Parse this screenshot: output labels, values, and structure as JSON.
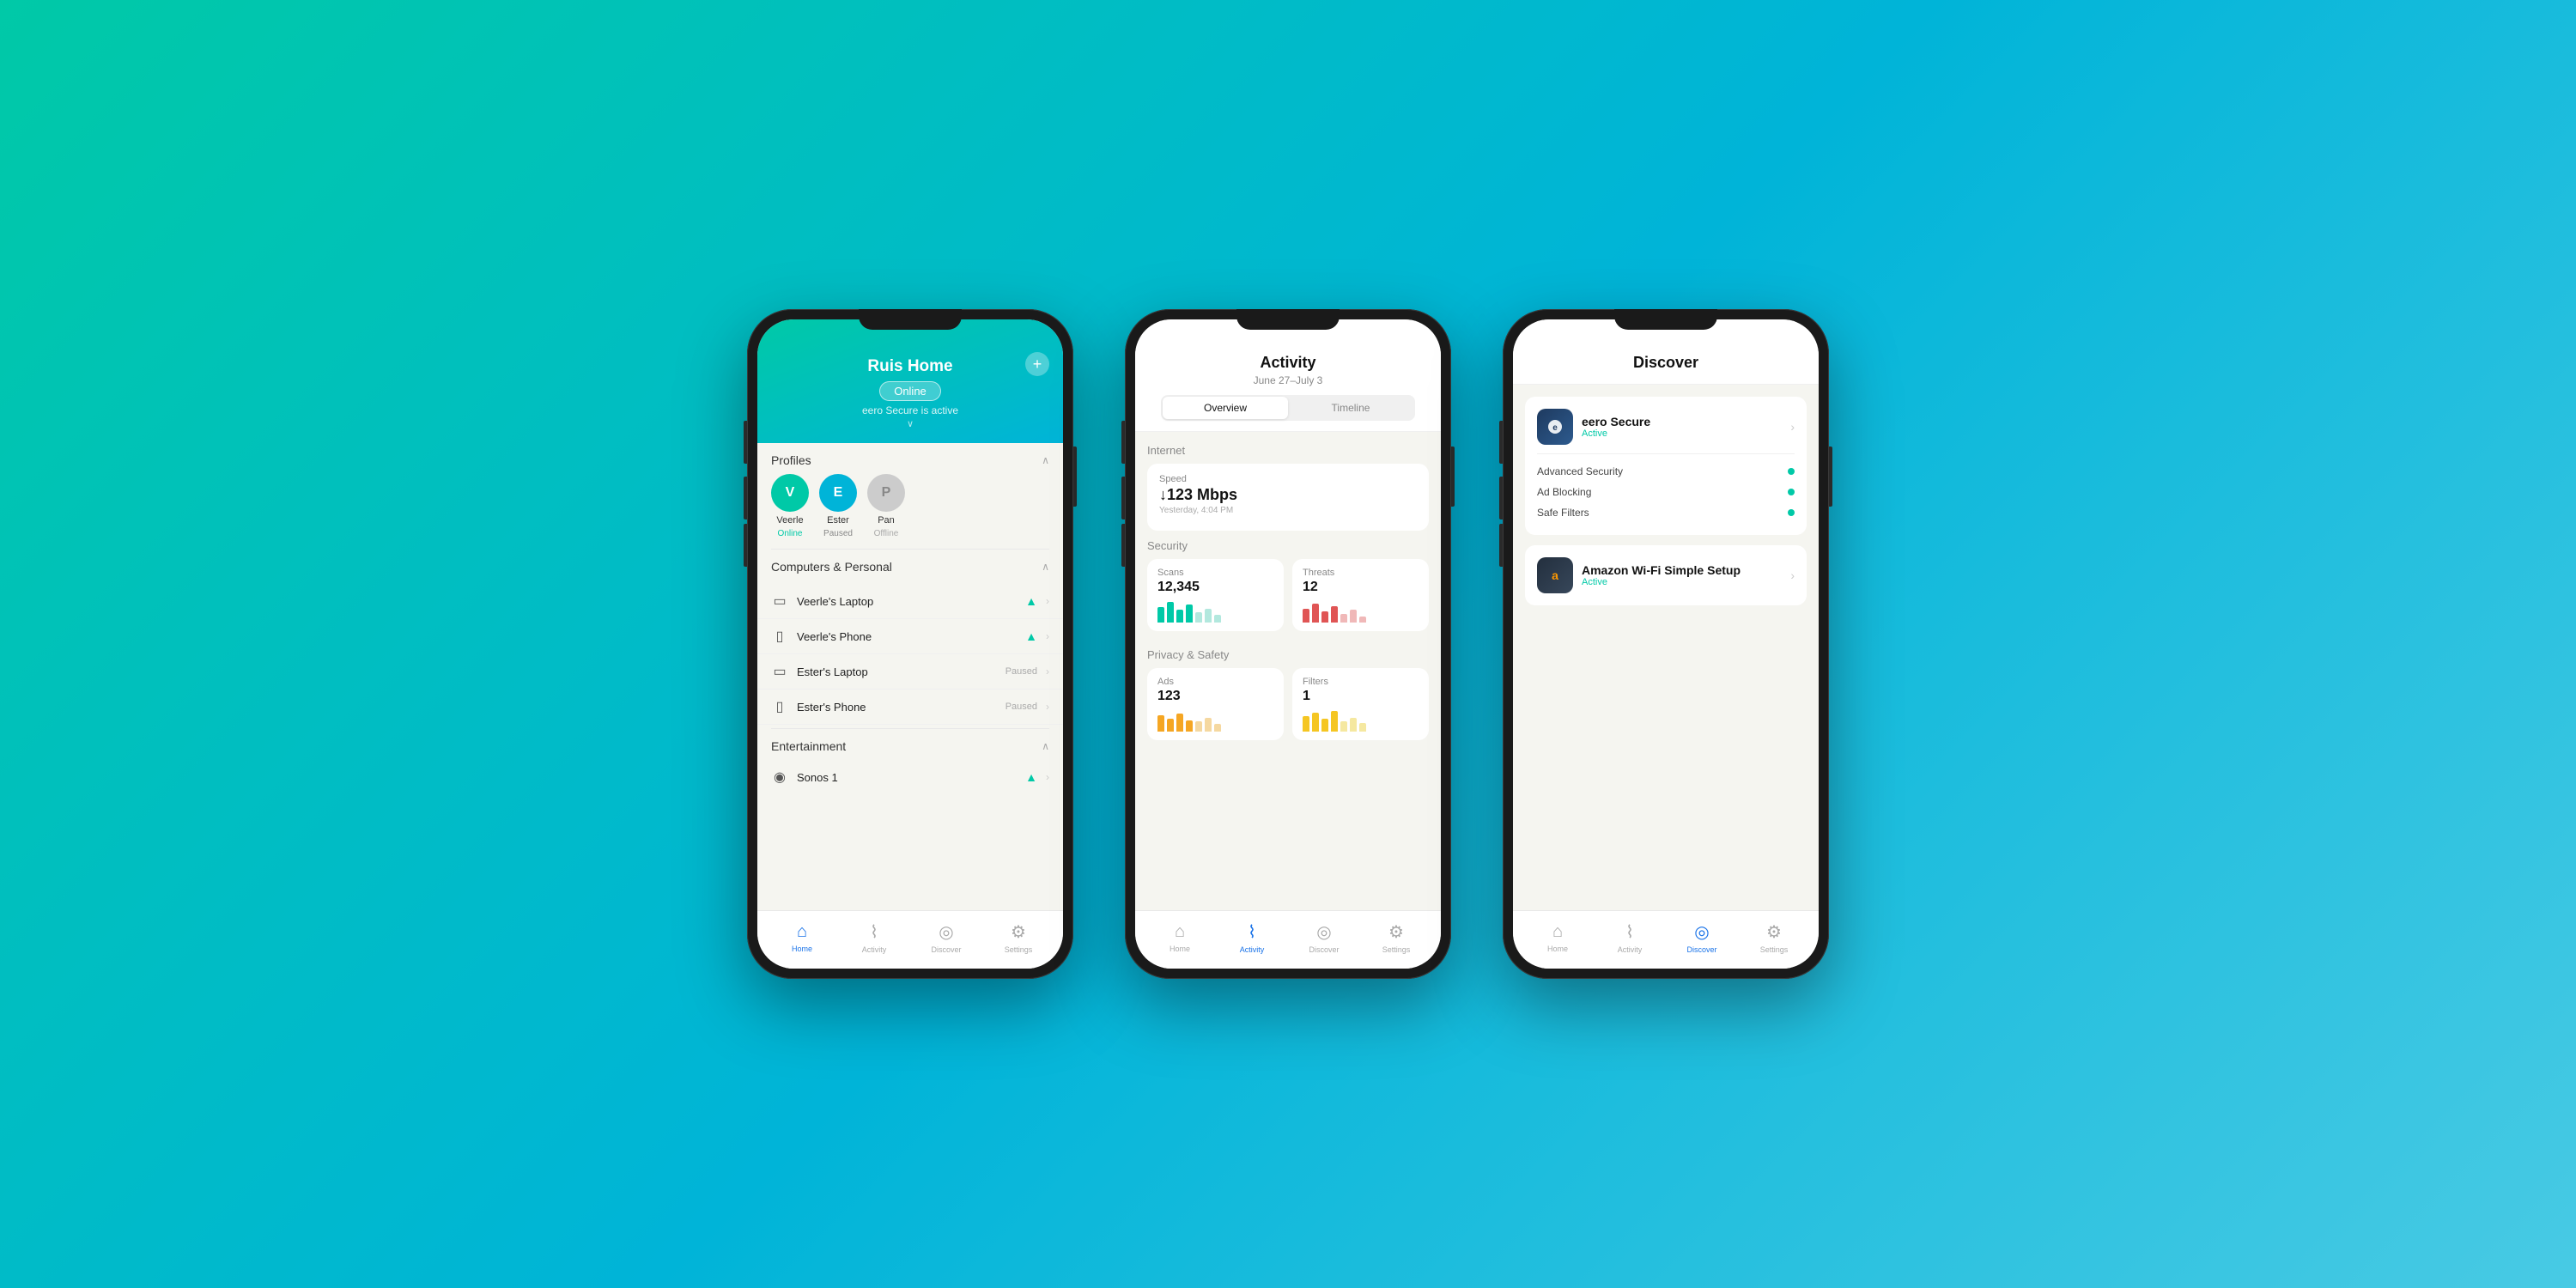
{
  "background": {
    "gradient_start": "#00c9a7",
    "gradient_end": "#48cae4"
  },
  "phone1": {
    "header": {
      "title": "Ruis Home",
      "status": "Online",
      "subtitle": "eero Secure is active",
      "plus_label": "+"
    },
    "profiles_section": {
      "title": "Profiles",
      "profiles": [
        {
          "initial": "V",
          "name": "Veerle",
          "status": "Online",
          "color": "green"
        },
        {
          "initial": "E",
          "name": "Ester",
          "status": "Paused",
          "color": "teal"
        },
        {
          "initial": "P",
          "name": "Pan",
          "status": "Offline",
          "color": "gray"
        }
      ]
    },
    "computers_section": {
      "title": "Computers & Personal",
      "devices": [
        {
          "type": "laptop",
          "name": "Veerle's Laptop",
          "status": "wifi"
        },
        {
          "type": "phone",
          "name": "Veerle's Phone",
          "status": "wifi"
        },
        {
          "type": "laptop",
          "name": "Ester's Laptop",
          "status": "Paused"
        },
        {
          "type": "phone",
          "name": "Ester's Phone",
          "status": "Paused"
        }
      ]
    },
    "entertainment_section": {
      "title": "Entertainment",
      "devices": [
        {
          "type": "speaker",
          "name": "Sonos 1",
          "status": "wifi"
        }
      ]
    },
    "nav": {
      "items": [
        {
          "icon": "⌂",
          "label": "Home",
          "active": true
        },
        {
          "icon": "♡",
          "label": "Activity",
          "active": false
        },
        {
          "icon": "◎",
          "label": "Discover",
          "active": false
        },
        {
          "icon": "⚙",
          "label": "Settings",
          "active": false
        }
      ]
    }
  },
  "phone2": {
    "header": {
      "title": "Activity",
      "date_range": "June 27–July 3",
      "tabs": [
        "Overview",
        "Timeline"
      ],
      "active_tab": "Overview"
    },
    "internet_section": {
      "label": "Internet",
      "speed_card": {
        "title": "Speed",
        "value": "↓123 Mbps",
        "sub": "Yesterday, 4:04 PM"
      }
    },
    "security_section": {
      "label": "Security",
      "scans_card": {
        "title": "Scans",
        "value": "12,345",
        "bars": [
          {
            "h": 60,
            "type": "green"
          },
          {
            "h": 80,
            "type": "green"
          },
          {
            "h": 50,
            "type": "green"
          },
          {
            "h": 70,
            "type": "green"
          },
          {
            "h": 40,
            "type": "green-light"
          },
          {
            "h": 55,
            "type": "green-light"
          },
          {
            "h": 30,
            "type": "green-light"
          }
        ]
      },
      "threats_card": {
        "title": "Threats",
        "value": "12",
        "bars": [
          {
            "h": 55,
            "type": "red"
          },
          {
            "h": 75,
            "type": "red"
          },
          {
            "h": 45,
            "type": "red"
          },
          {
            "h": 65,
            "type": "red"
          },
          {
            "h": 35,
            "type": "red-light"
          },
          {
            "h": 50,
            "type": "red-light"
          },
          {
            "h": 25,
            "type": "red-light"
          }
        ]
      }
    },
    "privacy_section": {
      "label": "Privacy & Safety",
      "ads_card": {
        "title": "Ads",
        "value": "123",
        "bars": [
          {
            "h": 65,
            "type": "orange"
          },
          {
            "h": 50,
            "type": "orange"
          },
          {
            "h": 70,
            "type": "orange"
          },
          {
            "h": 45,
            "type": "orange"
          },
          {
            "h": 40,
            "type": "orange-light"
          },
          {
            "h": 55,
            "type": "orange-light"
          },
          {
            "h": 30,
            "type": "orange-light"
          }
        ]
      },
      "filters_card": {
        "title": "Filters",
        "value": "1",
        "bars": [
          {
            "h": 60,
            "type": "yellow"
          },
          {
            "h": 75,
            "type": "yellow"
          },
          {
            "h": 50,
            "type": "yellow"
          },
          {
            "h": 80,
            "type": "yellow"
          },
          {
            "h": 40,
            "type": "yellow-light"
          },
          {
            "h": 55,
            "type": "yellow-light"
          },
          {
            "h": 35,
            "type": "yellow-light"
          }
        ]
      }
    },
    "nav": {
      "items": [
        {
          "icon": "⌂",
          "label": "Home",
          "active": false
        },
        {
          "icon": "♡",
          "label": "Activity",
          "active": true
        },
        {
          "icon": "◎",
          "label": "Discover",
          "active": false
        },
        {
          "icon": "⚙",
          "label": "Settings",
          "active": false
        }
      ]
    }
  },
  "phone3": {
    "header": {
      "title": "Discover"
    },
    "cards": [
      {
        "icon_type": "eero",
        "icon_char": "e",
        "name": "eero Secure",
        "status": "Active",
        "features": [
          {
            "name": "Advanced Security",
            "enabled": true
          },
          {
            "name": "Ad Blocking",
            "enabled": true
          },
          {
            "name": "Safe Filters",
            "enabled": true
          }
        ]
      },
      {
        "icon_type": "amazon",
        "icon_char": "a",
        "name": "Amazon Wi-Fi Simple Setup",
        "status": "Active",
        "features": []
      }
    ],
    "nav": {
      "items": [
        {
          "icon": "⌂",
          "label": "Home",
          "active": false
        },
        {
          "icon": "♡",
          "label": "Activity",
          "active": false
        },
        {
          "icon": "◎",
          "label": "Discover",
          "active": true
        },
        {
          "icon": "⚙",
          "label": "Settings",
          "active": false
        }
      ]
    }
  }
}
